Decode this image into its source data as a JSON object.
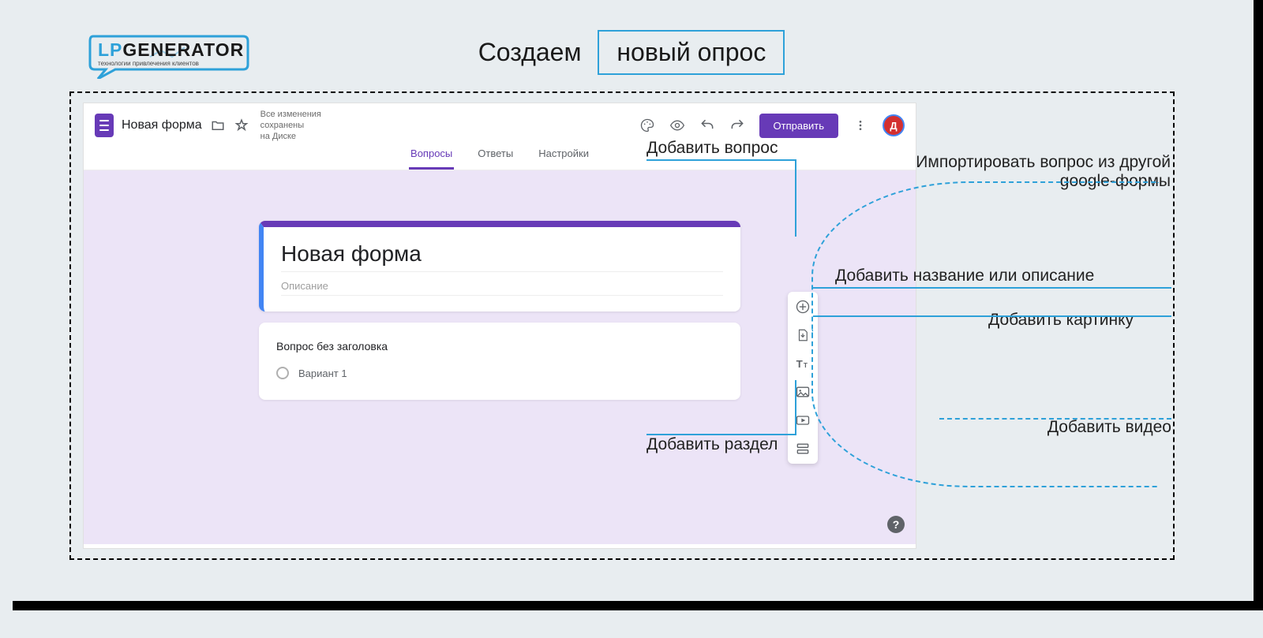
{
  "logo": {
    "main_a": "LP",
    "main_b": "GENERATOR",
    "sub": "технологии привлечения клиентов"
  },
  "heading": {
    "plain": "Создаем",
    "boxed": "новый опрос"
  },
  "header": {
    "form_name": "Новая форма",
    "save_status_l1": "Все изменения сохранены",
    "save_status_l2": "на Диске",
    "send_label": "Отправить",
    "avatar_letter": "Д"
  },
  "tabs": {
    "questions": "Вопросы",
    "answers": "Ответы",
    "settings": "Настройки"
  },
  "title_card": {
    "title": "Новая форма",
    "description": "Описание"
  },
  "question": {
    "title": "Вопрос без заголовка",
    "option1": "Вариант 1"
  },
  "annotations": {
    "add_question": "Добавить вопрос",
    "import_question_l1": "Импортировать вопрос из другой",
    "import_question_l2": "google-формы",
    "add_title_desc": "Добавить название или описание",
    "add_image": "Добавить картинку",
    "add_video": "Добавить видео",
    "add_section": "Добавить раздел"
  },
  "help": "?"
}
